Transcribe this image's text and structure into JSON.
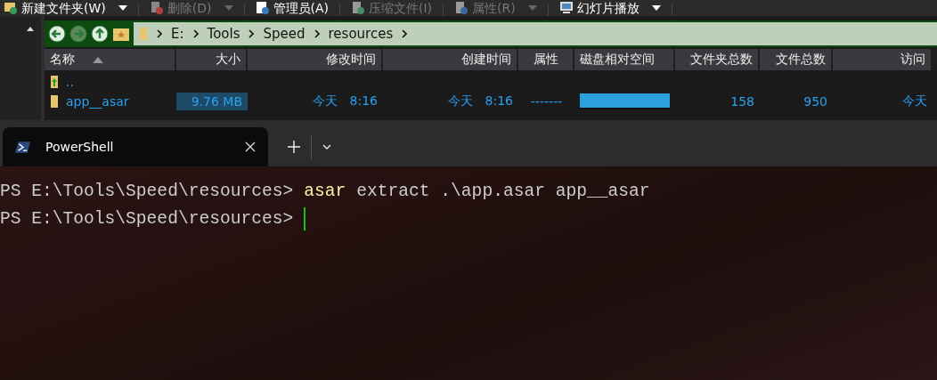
{
  "toolbar": {
    "buttons": [
      {
        "label": "新建文件夹(W)",
        "disabled": false,
        "dropdown": true
      },
      {
        "label": "删除(D)",
        "disabled": true,
        "dropdown": true
      },
      {
        "label": "管理员(A)",
        "disabled": false,
        "dropdown": false
      },
      {
        "label": "压缩文件(I)",
        "disabled": true,
        "dropdown": false
      },
      {
        "label": "属性(R)",
        "disabled": true,
        "dropdown": true
      },
      {
        "label": "幻灯片播放",
        "disabled": false,
        "dropdown": true
      }
    ]
  },
  "address_bar": {
    "back_disabled": false,
    "forward_disabled": true,
    "segments": [
      "E:",
      "Tools",
      "Speed",
      "resources"
    ]
  },
  "table": {
    "columns": [
      {
        "label": "名称",
        "sorted": true
      },
      {
        "label": "大小",
        "sorted": false
      },
      {
        "label": "修改时间",
        "sorted": false
      },
      {
        "label": "创建时间",
        "sorted": false
      },
      {
        "label": "属性",
        "sorted": false
      },
      {
        "label": "磁盘相对空间",
        "sorted": false
      },
      {
        "label": "文件夹总数",
        "sorted": false
      },
      {
        "label": "文件总数",
        "sorted": false
      },
      {
        "label": "访问",
        "sorted": false
      }
    ],
    "rows": [
      {
        "kind": "parent",
        "name": ".."
      },
      {
        "kind": "folder",
        "name": "app__asar",
        "size": "9.76 MB",
        "modified": "今天　8:16",
        "created": "今天　8:16",
        "attributes": "-------",
        "level": 1,
        "folders": "158",
        "files": "950",
        "accessed": "今天"
      }
    ]
  },
  "terminal": {
    "tabs": [
      {
        "title": "PowerShell",
        "selected": true
      }
    ],
    "lines": [
      {
        "prompt": "PS E:\\Tools\\Speed\\resources>",
        "command": "asar",
        "args": "extract .\\app.asar app__asar"
      },
      {
        "prompt": "PS E:\\Tools\\Speed\\resources>",
        "cursor": true
      }
    ]
  }
}
